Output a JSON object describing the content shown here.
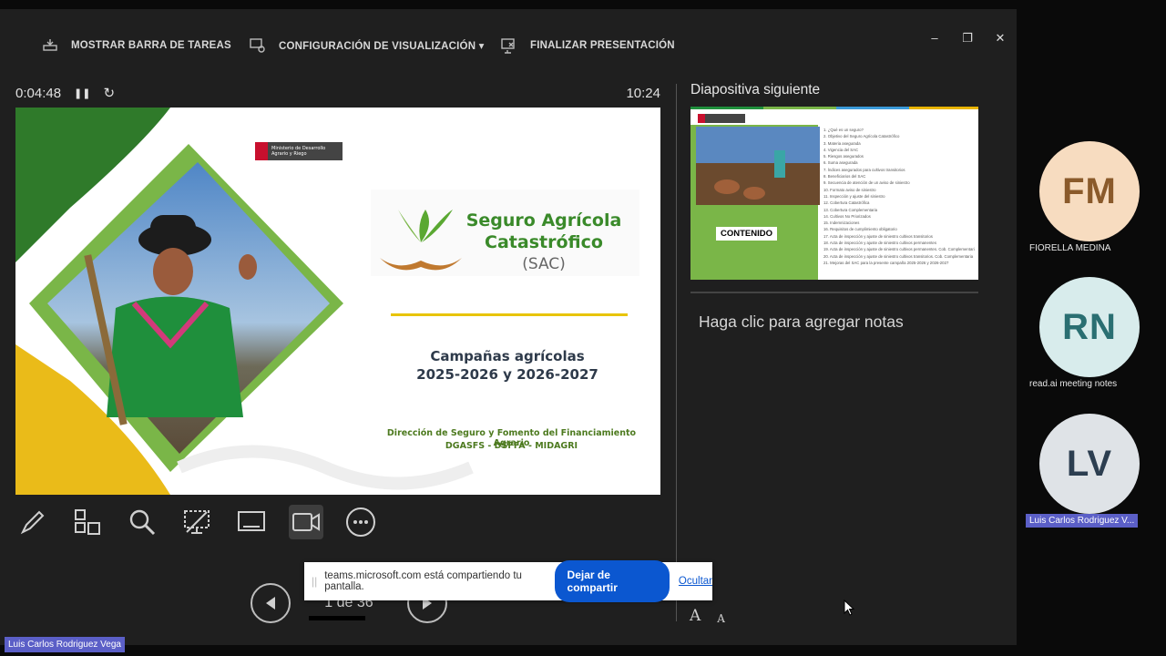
{
  "toolbar": {
    "taskbar_label": "MOSTRAR BARRA DE TAREAS",
    "display_settings_label": "CONFIGURACIÓN DE VISUALIZACIÓN ▾",
    "end_show_label": "FINALIZAR PRESENTACIÓN"
  },
  "window_controls": {
    "minimize": "–",
    "restore": "❐",
    "close": "✕"
  },
  "timer": {
    "elapsed": "0:04:48",
    "pause_glyph": "❚❚",
    "reset_glyph": "↻",
    "clock": "10:24"
  },
  "slide": {
    "ministry_logo_text": "Ministerio de Desarrollo Agrario y Riego",
    "title_line1": "Seguro Agrícola",
    "title_line2": "Catastrófico",
    "title_line3": "(SAC)",
    "campaign_line1": "Campañas agrícolas",
    "campaign_line2": "2025-2026 y 2026-2027",
    "footer_line1": "Dirección de Seguro y Fomento del Financiamiento Agrario",
    "footer_line2": "DGASFS - DSFFA - MIDAGRI"
  },
  "navigation": {
    "slide_counter": "1 de 36"
  },
  "next_slide": {
    "label": "Diapositiva siguiente",
    "contents_tag": "CONTENIDO",
    "toc": [
      "1. ¿Qué es un seguro?",
      "2. Objetivo del Seguro Agrícola Catastrófico",
      "3. Materia asegurada",
      "4. Vigencia del SAC",
      "5. Riesgos asegurados",
      "6. Suma asegurada",
      "7. Índices asegurados para cultivos transitorios",
      "8. Beneficiarios del SAC",
      "9. Secuencia de atención de un aviso de siniestro",
      "10. Formato aviso de siniestro",
      "11. Inspección y ajuste del siniestro",
      "12. Cobertura Catastrófica",
      "13. Cobertura Complementaria",
      "14. Cultivos No Priorizados",
      "15. Indemnizaciones",
      "16. Requisitos de cumplimiento obligatorio",
      "17. Acta de inspección y ajuste de siniestro cultivos transitorios",
      "18. Acta de inspección y ajuste de siniestro cultivos permanentes",
      "19. Acta de inspección y ajuste de siniestro cultivos permanentes. Cob. Complementaria",
      "20. Acta de inspección y ajuste de siniestro cultivos transitorios. Cob. Complementaria",
      "21. Mejoras del SAC para la presente campaña 2025-2026 y 2026-2027"
    ]
  },
  "notes": {
    "placeholder": "Haga clic para agregar notas"
  },
  "font_controls": {
    "increase": "A",
    "decrease": "A"
  },
  "participants": [
    {
      "initials": "FM",
      "name": "FIORELLA MEDINA",
      "bg": "#f7dcc0",
      "fg": "#8a5a2b"
    },
    {
      "initials": "RN",
      "name": "read.ai meeting notes",
      "bg": "#d8ecec",
      "fg": "#2a6f72"
    },
    {
      "initials": "LV",
      "name": "Luis Carlos Rodriguez V...",
      "bg": "#dfe3e7",
      "fg": "#2c3e50"
    }
  ],
  "self_view": {
    "name": "Luis Carlos Rodriguez Vega"
  },
  "share_bar": {
    "message": "teams.microsoft.com está compartiendo tu pantalla.",
    "stop_label": "Dejar de compartir",
    "hide_label": "Ocultar"
  },
  "colors": {
    "accent": "#5b5fc7",
    "share_blue": "#0b57d0",
    "slide_green": "#7ab648",
    "slide_yellow": "#e8b400"
  }
}
